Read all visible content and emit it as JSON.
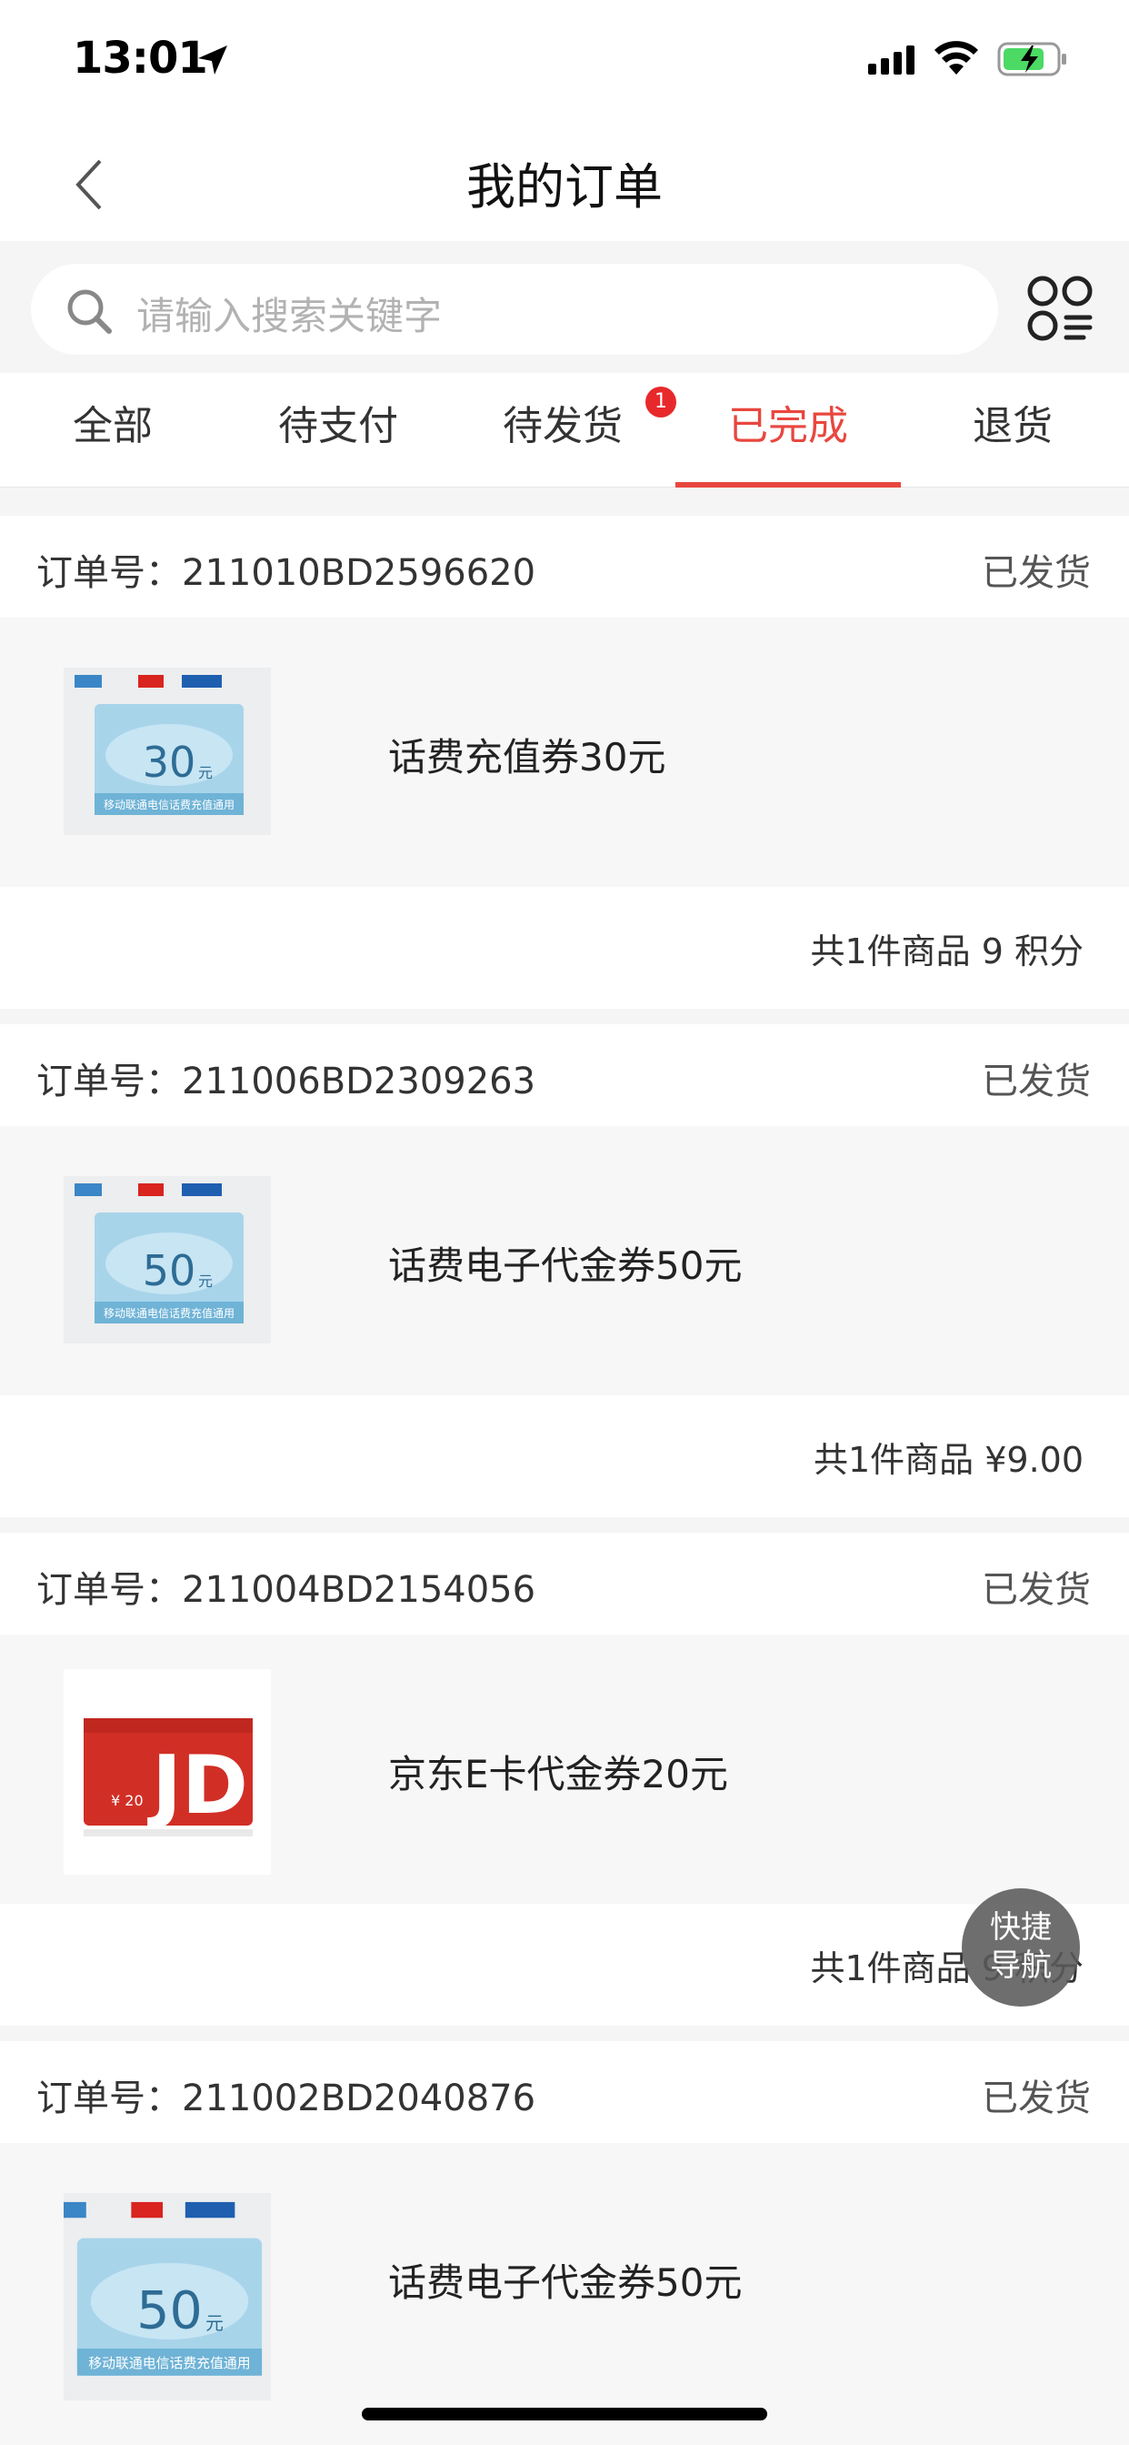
{
  "status_bar": {
    "time": "13:01"
  },
  "nav": {
    "title": "我的订单"
  },
  "search": {
    "placeholder": "请输入搜索关键字"
  },
  "tabs": [
    {
      "label": "全部"
    },
    {
      "label": "待支付"
    },
    {
      "label": "待发货",
      "badge": "1"
    },
    {
      "label": "已完成",
      "active": true
    },
    {
      "label": "退货"
    }
  ],
  "orders": [
    {
      "order_no": "订单号：211010BD2596620",
      "status": "已发货",
      "product": "话费充值券30元",
      "thumb_value": "30",
      "thumb_unit": "元",
      "thumb_caption": "移动联通电信话费充值通用",
      "summary": "共1件商品 9 积分"
    },
    {
      "order_no": "订单号：211006BD2309263",
      "status": "已发货",
      "product": "话费电子代金券50元",
      "thumb_value": "50",
      "thumb_unit": "元",
      "thumb_caption": "移动联通电信话费充值通用",
      "summary": "共1件商品 ¥9.00"
    },
    {
      "order_no": "订单号：211004BD2154056",
      "status": "已发货",
      "product": "京东E卡代金券20元",
      "thumb_value": "¥ 20",
      "thumb_brand": "JD",
      "summary": "共1件商品 9 积分"
    },
    {
      "order_no": "订单号：211002BD2040876",
      "status": "已发货",
      "product": "话费电子代金券50元",
      "thumb_value": "50",
      "thumb_unit": "元",
      "thumb_caption": "移动联通电信话费充值通用"
    }
  ],
  "fab": {
    "line1": "快捷",
    "line2": "导航"
  },
  "colors": {
    "accent": "#e8473f",
    "badge": "#e8292b"
  }
}
